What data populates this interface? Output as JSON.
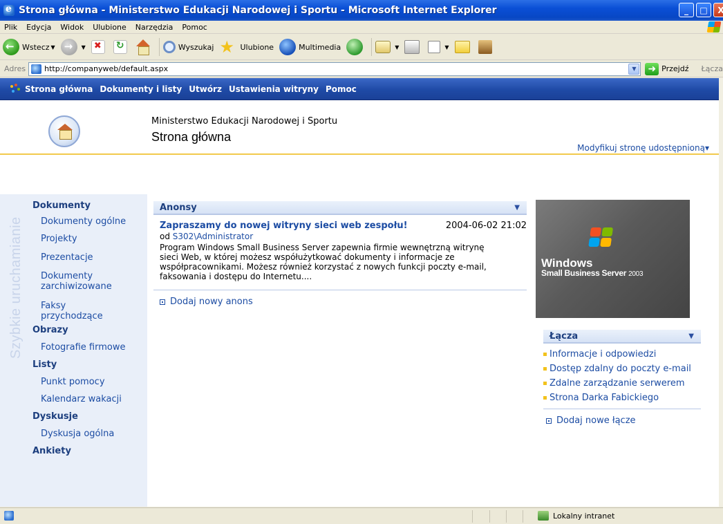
{
  "window": {
    "title": "Strona główna - Ministerstwo Edukacji Narodowej i Sportu - Microsoft Internet Explorer",
    "minimize": "_",
    "maximize": "□",
    "close": "X"
  },
  "menubar": [
    "Plik",
    "Edycja",
    "Widok",
    "Ulubione",
    "Narzędzia",
    "Pomoc"
  ],
  "toolbar": {
    "back": "Wstecz",
    "search": "Wyszukaj",
    "favorites": "Ulubione",
    "media": "Multimedia"
  },
  "address": {
    "label": "Adres",
    "url": "http://companyweb/default.aspx",
    "go": "Przejdź",
    "links": "Łącza"
  },
  "spnav": [
    "Strona główna",
    "Dokumenty i listy",
    "Utwórz",
    "Ustawienia witryny",
    "Pomoc"
  ],
  "header": {
    "site_name": "Ministerstwo Edukacji Narodowej i Sportu",
    "page_title": "Strona główna",
    "modify": "Modyfikuj stronę udostępnioną▾"
  },
  "quicklaunch": {
    "vertical_label": "Szybkie uruchamianie",
    "dokumenty": "Dokumenty",
    "dokumenty_items": [
      "Dokumenty ogólne",
      "Projekty",
      "Prezentacje",
      "Dokumenty zarchiwizowane",
      "Faksy przychodzące"
    ],
    "obrazy": "Obrazy",
    "obrazy_items": [
      "Fotografie firmowe"
    ],
    "listy": "Listy",
    "listy_items": [
      "Punkt pomocy",
      "Kalendarz wakacji"
    ],
    "dyskusje": "Dyskusje",
    "dyskusje_items": [
      "Dyskusja ogólna"
    ],
    "ankiety": "Ankiety"
  },
  "announcements": {
    "header": "Anonsy",
    "item_title": "Zapraszamy do nowej witryny sieci web zespołu!",
    "item_date": "2004-06-02 21:02",
    "by_prefix": "od",
    "by_user": "S302\\Administrator",
    "body": "Program Windows Small Business Server zapewnia firmie wewnętrzną witrynę sieci Web, w której możesz współużytkować dokumenty i informacje ze współpracownikami. Możesz również korzystać z nowych funkcji poczty e-mail, faksowania i dostępu do Internetu....",
    "add_new": "Dodaj nowy anons"
  },
  "sbs_image": {
    "line1": "Windows",
    "line2": "Small Business Server",
    "year": "2003"
  },
  "links": {
    "header": "Łącza",
    "items": [
      "Informacje i odpowiedzi",
      "Dostęp zdalny do poczty e-mail",
      "Zdalne zarządzanie serwerem",
      "Strona Darka Fabickiego"
    ],
    "add_new": "Dodaj nowe łącze"
  },
  "statusbar": {
    "zone": "Lokalny intranet"
  }
}
